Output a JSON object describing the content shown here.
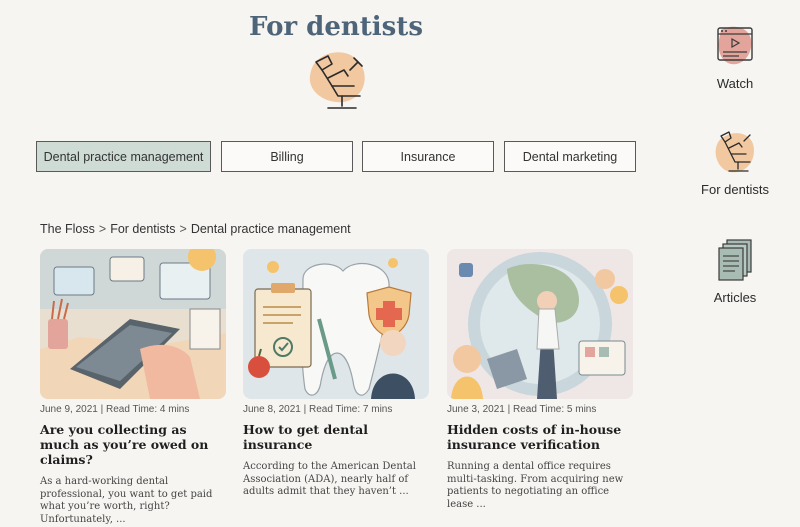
{
  "header": {
    "title": "For dentists"
  },
  "tabs": [
    {
      "label": "Dental practice management",
      "active": true
    },
    {
      "label": "Billing",
      "active": false
    },
    {
      "label": "Insurance",
      "active": false
    },
    {
      "label": "Dental marketing",
      "active": false
    }
  ],
  "breadcrumb": {
    "items": [
      "The Floss",
      "For dentists",
      "Dental practice management"
    ],
    "separator": ">"
  },
  "articles": [
    {
      "meta": "June 9, 2021 | Read Time: 4 mins",
      "title": "Are you collecting as much as you’re owed on claims?",
      "excerpt": "As a hard-working dental professional, you want to get paid what you’re worth, right? Unfortunately, ..."
    },
    {
      "meta": "June 8, 2021 | Read Time: 7 mins",
      "title": "How to get dental insurance",
      "excerpt": "According to the American Dental Association (ADA), nearly half of adults admit that they haven’t ..."
    },
    {
      "meta": "June 3, 2021 | Read Time: 5 mins",
      "title": "Hidden costs of in-house insurance verification",
      "excerpt": "Running a dental office requires multi-tasking. From acquiring new patients to negotiating an office lease ..."
    }
  ],
  "sidebar": {
    "items": [
      {
        "label": "Watch",
        "icon": "video-player-icon"
      },
      {
        "label": "For dentists",
        "icon": "dental-chair-icon"
      },
      {
        "label": "Articles",
        "icon": "documents-icon"
      }
    ]
  },
  "colors": {
    "accent_title": "#4e6478",
    "active_tab": "#cfdcd6",
    "peach_blob": "#f2c8a0",
    "pink_accent": "#e3a49b",
    "sage": "#a9bcb4"
  }
}
